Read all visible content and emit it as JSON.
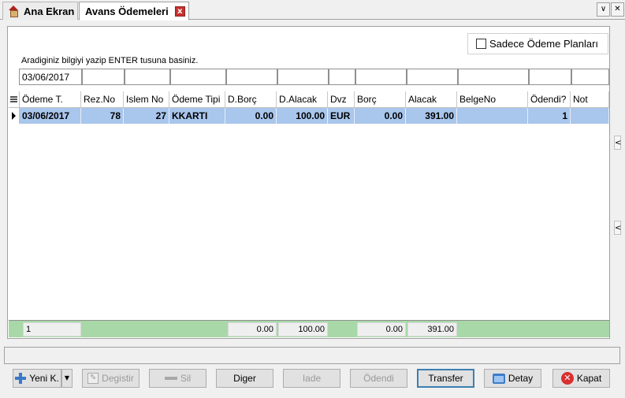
{
  "tabs": [
    {
      "label": "Ana Ekran",
      "icon": "home-icon"
    },
    {
      "label": "Avans Ödemeleri",
      "icon": "close-icon",
      "close": "x"
    }
  ],
  "window_controls": {
    "dropdown": "∨",
    "close": "✕"
  },
  "filter": {
    "checkbox_label": "Sadece Ödeme Planları",
    "checked": false,
    "hint": "Aradiginiz bilgiyi yazip ENTER tusuna basiniz.",
    "date_value": "03/06/2017"
  },
  "grid": {
    "columns": [
      "Ödeme T.",
      "Rez.No",
      "Islem No",
      "Ödeme Tipi",
      "D.Borç",
      "D.Alacak",
      "Dvz",
      "Borç",
      "Alacak",
      "BelgeNo",
      "Ödendi?",
      "Not"
    ],
    "rows": [
      {
        "odeme_t": "03/06/2017",
        "rez_no": "78",
        "islem_no": "27",
        "odeme_tipi": "KKARTI",
        "d_borc": "0.00",
        "d_alacak": "100.00",
        "dvz": "EUR",
        "borc": "0.00",
        "alacak": "391.00",
        "belge_no": "",
        "odendi": "1",
        "not": ""
      }
    ],
    "footer": {
      "count": "1",
      "d_borc": "0.00",
      "d_alacak": "100.00",
      "borc": "0.00",
      "alacak": "391.00"
    }
  },
  "side_arrows": [
    "<",
    "<"
  ],
  "buttons": {
    "yeni": "Yeni K.",
    "degistir": "Degistir",
    "sil": "Sil",
    "diger": "Diger",
    "iade": "Iade",
    "odendi": "Ödendi",
    "transfer": "Transfer",
    "detay": "Detay",
    "kapat": "Kapat"
  },
  "colors": {
    "selected_row": "#a9c6ec",
    "footer": "#a8d8a8"
  }
}
